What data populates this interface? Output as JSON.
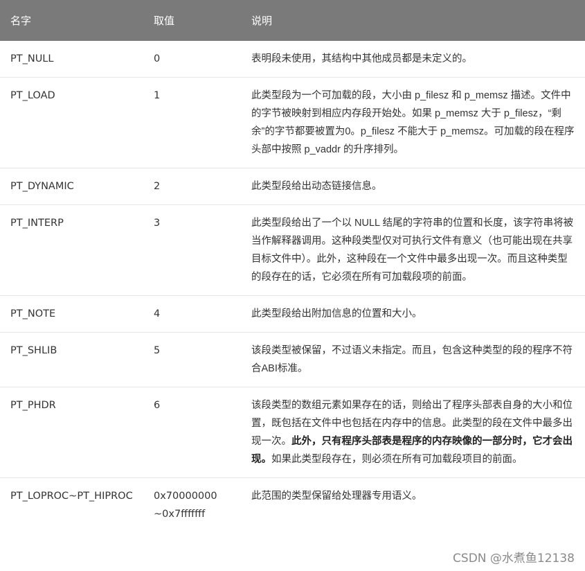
{
  "table": {
    "headers": [
      "名字",
      "取值",
      "说明"
    ],
    "rows": [
      {
        "name": "PT_NULL",
        "value": "0",
        "desc": [
          {
            "t": "表明段未使用，其结构中其他成员都是未定义的。"
          }
        ]
      },
      {
        "name": "PT_LOAD",
        "value": "1",
        "desc": [
          {
            "t": "此类型段为一个可加载的段，大小由 p_filesz 和 p_memsz 描述。文件中的字节被映射到相应内存段开始处。如果 p_memsz 大于 p_filesz，“剩余”的字节都要被置为0。p_filesz 不能大于 p_memsz。可加载的段在程序头部中按照 p_vaddr 的升序排列。"
          }
        ]
      },
      {
        "name": "PT_DYNAMIC",
        "value": "2",
        "desc": [
          {
            "t": "此类型段给出动态链接信息。"
          }
        ]
      },
      {
        "name": "PT_INTERP",
        "value": "3",
        "desc": [
          {
            "t": "此类型段给出了一个以 NULL 结尾的字符串的位置和长度，该字符串将被当作解释器调用。这种段类型仅对可执行文件有意义（也可能出现在共享目标文件中）。此外，这种段在一个文件中最多出现一次。而且这种类型的段存在的话，它必须在所有可加载段项的前面。"
          }
        ]
      },
      {
        "name": "PT_NOTE",
        "value": "4",
        "desc": [
          {
            "t": "此类型段给出附加信息的位置和大小。"
          }
        ]
      },
      {
        "name": "PT_SHLIB",
        "value": "5",
        "desc": [
          {
            "t": "该段类型被保留，不过语义未指定。而且，包含这种类型的段的程序不符合ABI标准。"
          }
        ]
      },
      {
        "name": "PT_PHDR",
        "value": "6",
        "desc": [
          {
            "t": "该段类型的数组元素如果存在的话，则给出了程序头部表自身的大小和位置，既包括在文件中也包括在内存中的信息。此类型的段在文件中最多出现一次。"
          },
          {
            "t": "此外，只有程序头部表是程序的内存映像的一部分时，它才会出现。",
            "b": true
          },
          {
            "t": "如果此类型段存在，则必须在所有可加载段项目的前面。"
          }
        ]
      },
      {
        "name": "PT_LOPROC~PT_HIPROC",
        "value": "0x70000000 ~0x7fffffff",
        "desc": [
          {
            "t": "此范围的类型保留给处理器专用语义。"
          }
        ]
      }
    ]
  },
  "watermark": "CSDN @水煮鱼12138"
}
